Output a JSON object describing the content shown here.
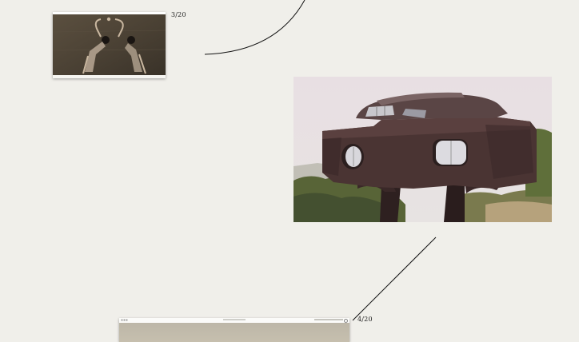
{
  "slides": [
    {
      "counter": "3/20",
      "thumbnail_icon": "dancers-photo-icon"
    },
    {
      "counter": "4/20",
      "thumbnail_icon": "browser-window-icon"
    }
  ],
  "featured_image": {
    "icon": "brutalist-house-photo-icon"
  },
  "colors": {
    "background": "#f0efea",
    "line": "#111111",
    "sky": "#e6dee2",
    "building": "#3a2a2a",
    "vegetation": "#5b6b3a"
  }
}
